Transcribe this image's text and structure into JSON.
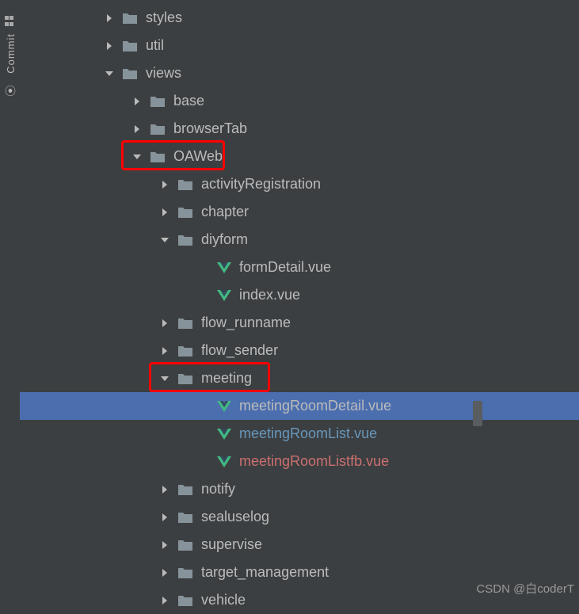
{
  "sideTab": {
    "label": "Commit"
  },
  "rows": [
    {
      "indent": 105,
      "expand": "collapsed",
      "type": "folder",
      "text": "styles"
    },
    {
      "indent": 105,
      "expand": "collapsed",
      "type": "folder",
      "text": "util"
    },
    {
      "indent": 105,
      "expand": "expanded",
      "type": "folder",
      "text": "views"
    },
    {
      "indent": 140,
      "expand": "collapsed",
      "type": "folder",
      "text": "base"
    },
    {
      "indent": 140,
      "expand": "collapsed",
      "type": "folder",
      "text": "browserTab"
    },
    {
      "indent": 140,
      "expand": "expanded",
      "type": "folder",
      "text": "OAWeb",
      "highlight": true
    },
    {
      "indent": 175,
      "expand": "collapsed",
      "type": "folder",
      "text": "activityRegistration"
    },
    {
      "indent": 175,
      "expand": "collapsed",
      "type": "folder",
      "text": "chapter"
    },
    {
      "indent": 175,
      "expand": "expanded",
      "type": "folder",
      "text": "diyform"
    },
    {
      "indent": 225,
      "expand": "none",
      "type": "vue",
      "text": "formDetail.vue"
    },
    {
      "indent": 225,
      "expand": "none",
      "type": "vue",
      "text": "index.vue"
    },
    {
      "indent": 175,
      "expand": "collapsed",
      "type": "folder",
      "text": "flow_runname"
    },
    {
      "indent": 175,
      "expand": "collapsed",
      "type": "folder",
      "text": "flow_sender"
    },
    {
      "indent": 175,
      "expand": "expanded",
      "type": "folder",
      "text": "meeting",
      "highlight": true
    },
    {
      "indent": 225,
      "expand": "none",
      "type": "vue",
      "text": "meetingRoomDetail.vue",
      "selected": true
    },
    {
      "indent": 225,
      "expand": "none",
      "type": "vue",
      "text": "meetingRoomList.vue",
      "colorClass": "color-blue"
    },
    {
      "indent": 225,
      "expand": "none",
      "type": "vue",
      "text": "meetingRoomListfb.vue",
      "colorClass": "color-red"
    },
    {
      "indent": 175,
      "expand": "collapsed",
      "type": "folder",
      "text": "notify"
    },
    {
      "indent": 175,
      "expand": "collapsed",
      "type": "folder",
      "text": "sealuselog"
    },
    {
      "indent": 175,
      "expand": "collapsed",
      "type": "folder",
      "text": "supervise"
    },
    {
      "indent": 175,
      "expand": "collapsed",
      "type": "folder",
      "text": "target_management"
    },
    {
      "indent": 175,
      "expand": "collapsed",
      "type": "folder",
      "text": "vehicle"
    }
  ],
  "watermark": "CSDN @白coderT"
}
